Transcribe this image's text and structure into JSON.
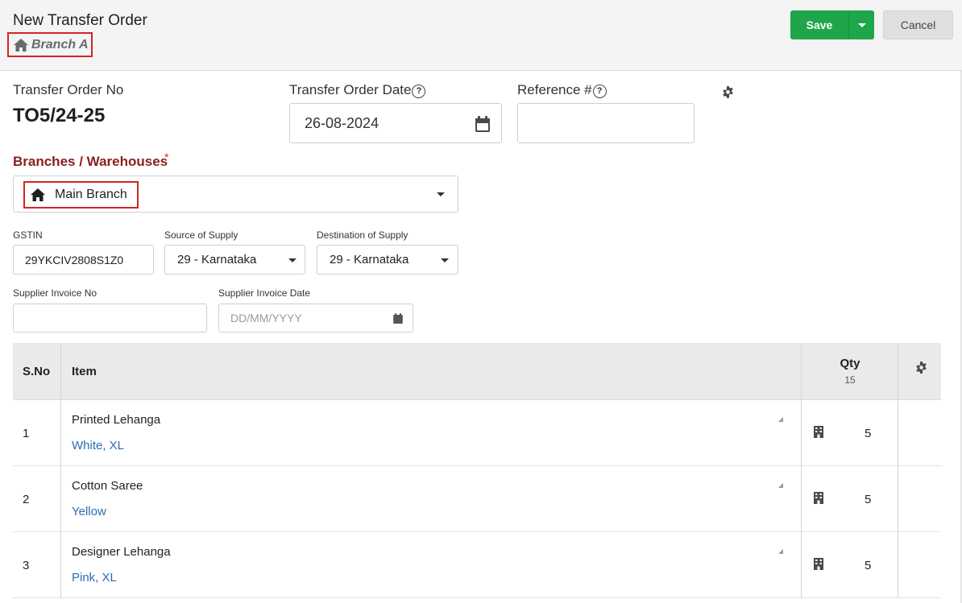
{
  "header": {
    "title": "New Transfer Order",
    "branch": "Branch A",
    "save_label": "Save",
    "cancel_label": "Cancel"
  },
  "form": {
    "to_no_label": "Transfer Order No",
    "to_no_value": "TO5/24-25",
    "to_date_label": "Transfer Order Date",
    "to_date_value": "26-08-2024",
    "reference_label": "Reference #",
    "reference_value": "",
    "branches_label": "Branches / Warehouses",
    "required_mark": "*",
    "branch_value": "Main Branch",
    "gstin_label": "GSTIN",
    "gstin_value": "29YKCIV2808S1Z0",
    "source_label": "Source of Supply",
    "source_value": "29 - Karnataka",
    "destination_label": "Destination of Supply",
    "destination_value": "29 - Karnataka",
    "supplier_invoice_no_label": "Supplier Invoice No",
    "supplier_invoice_no_value": "",
    "supplier_invoice_date_label": "Supplier Invoice Date",
    "supplier_invoice_date_placeholder": "DD/MM/YYYY"
  },
  "table": {
    "headers": {
      "sno": "S.No",
      "item": "Item",
      "qty": "Qty",
      "qty_total": "15"
    },
    "rows": [
      {
        "sno": "1",
        "item": "Printed Lehanga",
        "variant": "White, XL",
        "qty": "5"
      },
      {
        "sno": "2",
        "item": "Cotton Saree",
        "variant": "Yellow",
        "qty": "5"
      },
      {
        "sno": "3",
        "item": "Designer Lehanga",
        "variant": "Pink, XL",
        "qty": "5"
      }
    ]
  },
  "colors": {
    "primary_green": "#1fa54a",
    "required_red": "#d42424",
    "label_maroon": "#8a1e1e",
    "link_blue": "#2a6db5"
  },
  "icons": [
    "home-icon",
    "calendar-icon",
    "help-icon",
    "gear-icon",
    "chevron-down-icon",
    "building-icon"
  ]
}
